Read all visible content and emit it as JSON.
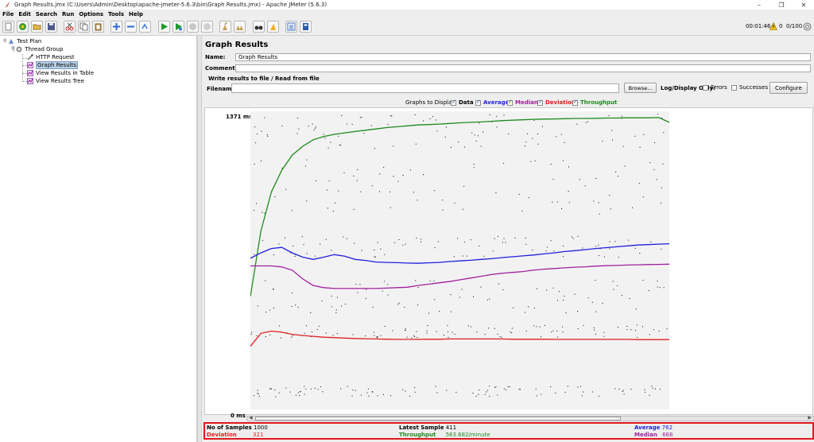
{
  "window": {
    "title": "Graph Results.jmx (C:\\Users\\Admin\\Desktop\\apache-jmeter-5.6.3\\bin\\Graph Results.jmx) - Apache JMeter (5.6.3)",
    "minimize": "–",
    "restore": "❐",
    "close": "✕"
  },
  "menu": [
    "File",
    "Edit",
    "Search",
    "Run",
    "Options",
    "Tools",
    "Help"
  ],
  "toolbar_status": {
    "elapsed": "00:01:46",
    "warnings": "0",
    "threads": "0/100"
  },
  "tree": {
    "items": [
      {
        "label": "Test Plan",
        "icon": "test-plan-icon"
      },
      {
        "label": "Thread Group",
        "icon": "gear-icon"
      },
      {
        "label": "HTTP Request",
        "icon": "pipette-icon"
      },
      {
        "label": "Graph Results",
        "icon": "graph-icon"
      },
      {
        "label": "View Results in Table",
        "icon": "graph-icon"
      },
      {
        "label": "View Results Tree",
        "icon": "graph-icon"
      }
    ]
  },
  "panel": {
    "title": "Graph Results",
    "name_label": "Name:",
    "name_value": "Graph Results",
    "comments_label": "Comments:",
    "comments_value": "",
    "file_section": "Write results to file / Read from file",
    "filename_label": "Filename",
    "filename_value": "",
    "browse": "Browse...",
    "log_display_only": "Log/Display Only:",
    "errors": "Errors",
    "successes": "Successes",
    "configure": "Configure",
    "graphs_to_display": "Graphs to Display",
    "toggles": [
      {
        "label": "Data",
        "color": "#000000",
        "checked": true
      },
      {
        "label": "Average",
        "color": "#1f1fe0",
        "checked": true
      },
      {
        "label": "Median",
        "color": "#a020a0",
        "checked": true
      },
      {
        "label": "Deviation",
        "color": "#e01f1f",
        "checked": true
      },
      {
        "label": "Throughput",
        "color": "#1f8a1f",
        "checked": true
      }
    ]
  },
  "chart_data": {
    "type": "line",
    "x_label": "",
    "y_label": "",
    "y_max_label": "1371  ms",
    "y_min_label": "0  ms",
    "ylim": [
      0,
      1371
    ],
    "series_colors": {
      "average": "#1f1fe0",
      "median": "#a020a0",
      "deviation": "#e01f1f",
      "throughput": "#1f8a1f",
      "data": "#000000"
    },
    "average": [
      695,
      720,
      740,
      745,
      720,
      700,
      690,
      700,
      712,
      705,
      690,
      685,
      678,
      676,
      675,
      673,
      672,
      674,
      676,
      680,
      683,
      686,
      690,
      693,
      698,
      702,
      706,
      710,
      715,
      720,
      726,
      730,
      735,
      740,
      744,
      748,
      752,
      756,
      758,
      760,
      762
    ],
    "median": [
      660,
      660,
      660,
      655,
      640,
      600,
      570,
      560,
      556,
      556,
      556,
      556,
      556,
      558,
      560,
      562,
      570,
      576,
      582,
      588,
      596,
      604,
      612,
      620,
      626,
      630,
      634,
      640,
      645,
      648,
      651,
      654,
      656,
      659,
      661,
      662,
      664,
      665,
      666,
      667,
      668
    ],
    "deviation": [
      290,
      350,
      360,
      355,
      345,
      340,
      336,
      332,
      330,
      328,
      326,
      325,
      324,
      323,
      322,
      322,
      322,
      323,
      323,
      324,
      324,
      324,
      324,
      324,
      324,
      323,
      323,
      323,
      323,
      322,
      322,
      322,
      322,
      322,
      322,
      322,
      322,
      321,
      321,
      321,
      321
    ],
    "throughput_ms_scale": [
      520,
      820,
      1000,
      1100,
      1170,
      1210,
      1240,
      1255,
      1265,
      1272,
      1278,
      1284,
      1290,
      1296,
      1300,
      1304,
      1308,
      1310,
      1312,
      1315,
      1318,
      1320,
      1322,
      1325,
      1328,
      1330,
      1332,
      1334,
      1335,
      1336,
      1337,
      1338,
      1338,
      1339,
      1340,
      1340,
      1341,
      1341,
      1341,
      1342,
      1320
    ]
  },
  "summary": {
    "samples_label": "No of Samples",
    "samples_value": "1000",
    "deviation_label": "Deviation",
    "deviation_value": "321",
    "latest_label": "Latest Sample",
    "latest_value": "411",
    "throughput_label": "Throughput",
    "throughput_value": "563.682/minute",
    "average_label": "Average",
    "average_value": "762",
    "median_label": "Median",
    "median_value": "668",
    "colors": {
      "deviation": "#e01f1f",
      "throughput": "#1f8a1f",
      "average": "#1f1fe0",
      "median": "#a020a0"
    }
  }
}
